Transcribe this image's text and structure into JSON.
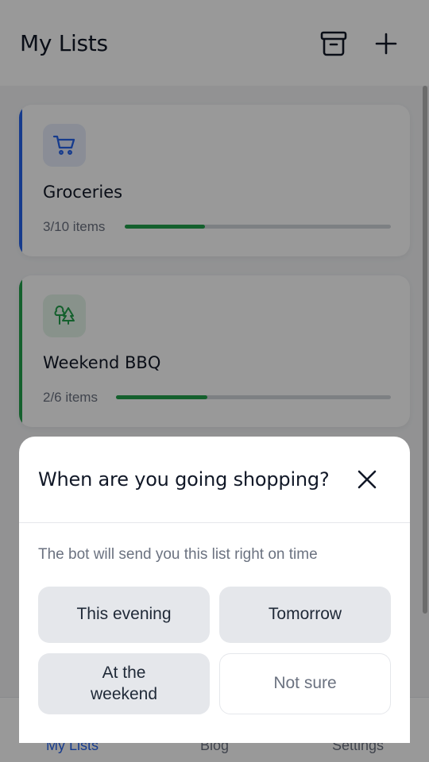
{
  "header": {
    "title": "My Lists",
    "archive_icon": "archive-icon",
    "add_icon": "plus-icon"
  },
  "lists": [
    {
      "title": "Groceries",
      "count": "3/10 items",
      "progress": 0.3,
      "icon": "cart-icon",
      "accent": "#2563eb"
    },
    {
      "title": "Weekend BBQ",
      "count": "2/6 items",
      "progress": 0.333,
      "icon": "trees-icon",
      "accent": "#22a04b"
    }
  ],
  "tabs": [
    {
      "label": "My Lists",
      "active": true
    },
    {
      "label": "Blog",
      "active": false
    },
    {
      "label": "Settings",
      "active": false
    }
  ],
  "sheet": {
    "title": "When are you going shopping?",
    "subtitle": "The bot will send you this list right on time",
    "options": [
      "This evening",
      "Tomorrow",
      "At the weekend",
      "Not sure"
    ]
  }
}
